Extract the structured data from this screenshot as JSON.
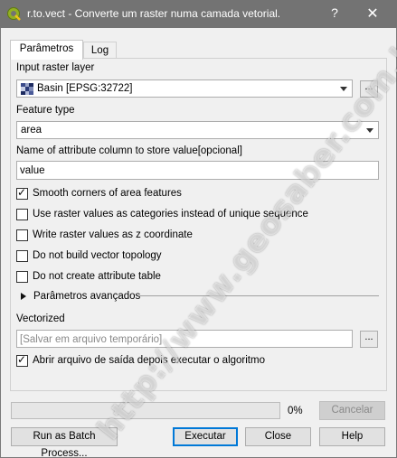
{
  "titlebar": {
    "title": "r.to.vect - Converte um raster numa camada vetorial.",
    "help": "?",
    "close": "✕"
  },
  "tabs": [
    {
      "label": "Parâmetros",
      "active": true
    },
    {
      "label": "Log",
      "active": false
    }
  ],
  "form": {
    "input_raster_label": "Input raster layer",
    "input_raster_value": "Basin [EPSG:32722]",
    "feature_type_label": "Feature type",
    "feature_type_value": "area",
    "attr_column_label": "Name of attribute column to store value[opcional]",
    "attr_column_value": "value",
    "browse_label": "...",
    "checkboxes": [
      {
        "label": "Smooth corners of area features",
        "checked": true
      },
      {
        "label": "Use raster values as categories instead of unique sequence",
        "checked": false
      },
      {
        "label": "Write raster values as z coordinate",
        "checked": false
      },
      {
        "label": "Do not build vector topology",
        "checked": false
      },
      {
        "label": "Do not create attribute table",
        "checked": false
      }
    ],
    "advanced_label": "Parâmetros avançados",
    "vectorized_label": "Vectorized",
    "vectorized_placeholder": "[Salvar em arquivo temporário]",
    "open_output": {
      "label": "Abrir arquivo de saída depois executar o algoritmo",
      "checked": true
    }
  },
  "footer": {
    "progress_value": 0,
    "progress_text": "0%",
    "cancel": "Cancelar",
    "batch": "Run as Batch Process...",
    "execute": "Executar",
    "close": "Close",
    "help": "Help"
  },
  "watermark": "http://www.geosaber.com.br"
}
